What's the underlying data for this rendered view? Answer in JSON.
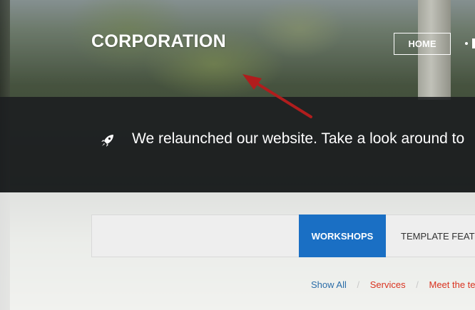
{
  "header": {
    "brand": "CORPORATION",
    "nav": {
      "home_label": "HOME"
    }
  },
  "announcement": {
    "text": "We relaunched our website. Take a look around to"
  },
  "tabs": {
    "workshops_label": "WORKSHOPS",
    "template_label": "TEMPLATE FEATU"
  },
  "filters": {
    "show_all": "Show All",
    "separator": "/",
    "services": "Services",
    "meet_team": "Meet the tea"
  },
  "colors": {
    "accent_blue": "#1a6fc4",
    "filter_red": "#d9321f",
    "link_blue": "#2a6da8",
    "annotation_arrow": "#b01d1d"
  },
  "icons": {
    "announcement": "rocket-icon"
  }
}
